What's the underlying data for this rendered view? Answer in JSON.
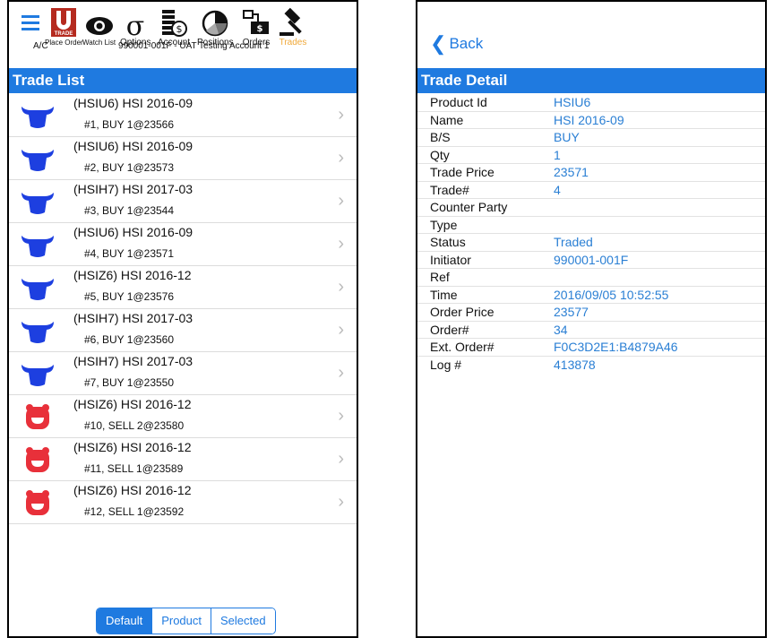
{
  "toolbar": {
    "items": [
      {
        "label": "Place Order",
        "icon": "trade-logo-icon"
      },
      {
        "label": "Watch List",
        "icon": "eye-icon"
      },
      {
        "label": "Options",
        "icon": "sigma-icon"
      },
      {
        "label": "Account",
        "icon": "coin-stack-icon"
      },
      {
        "label": "Positions",
        "icon": "pie-chart-icon"
      },
      {
        "label": "Orders",
        "icon": "orders-icon"
      },
      {
        "label": "Trades",
        "icon": "gavel-icon"
      }
    ],
    "logo_text": "TRADE",
    "account_label": "A/C",
    "account_value": "990001-001F - UAT Testing Account 1"
  },
  "trade_list": {
    "title": "Trade List",
    "rows": [
      {
        "line1": "(HSIU6) HSI 2016-09",
        "line2": "#1, BUY 1@23566",
        "side": "buy"
      },
      {
        "line1": "(HSIU6) HSI 2016-09",
        "line2": "#2, BUY 1@23573",
        "side": "buy"
      },
      {
        "line1": "(HSIH7) HSI 2017-03",
        "line2": "#3, BUY 1@23544",
        "side": "buy"
      },
      {
        "line1": "(HSIU6) HSI 2016-09",
        "line2": "#4, BUY 1@23571",
        "side": "buy"
      },
      {
        "line1": "(HSIZ6) HSI 2016-12",
        "line2": "#5, BUY 1@23576",
        "side": "buy"
      },
      {
        "line1": "(HSIH7) HSI 2017-03",
        "line2": "#6, BUY 1@23560",
        "side": "buy"
      },
      {
        "line1": "(HSIH7) HSI 2017-03",
        "line2": "#7, BUY 1@23550",
        "side": "buy"
      },
      {
        "line1": "(HSIZ6) HSI 2016-12",
        "line2": "#10, SELL 2@23580",
        "side": "sell"
      },
      {
        "line1": "(HSIZ6) HSI 2016-12",
        "line2": "#11, SELL 1@23589",
        "side": "sell"
      },
      {
        "line1": "(HSIZ6) HSI 2016-12",
        "line2": "#12, SELL 1@23592",
        "side": "sell"
      }
    ],
    "segments": [
      "Default",
      "Product",
      "Selected"
    ],
    "selected_segment": "Default"
  },
  "trade_detail": {
    "back_label": "Back",
    "title": "Trade Detail",
    "fields": [
      {
        "key": "Product Id",
        "value": "HSIU6"
      },
      {
        "key": "Name",
        "value": "HSI 2016-09"
      },
      {
        "key": "B/S",
        "value": "BUY"
      },
      {
        "key": "Qty",
        "value": "1"
      },
      {
        "key": "Trade Price",
        "value": "23571"
      },
      {
        "key": "Trade#",
        "value": "4"
      },
      {
        "key": "Counter Party",
        "value": ""
      },
      {
        "key": "Type",
        "value": ""
      },
      {
        "key": "Status",
        "value": "Traded"
      },
      {
        "key": "Initiator",
        "value": "990001-001F"
      },
      {
        "key": "Ref",
        "value": ""
      },
      {
        "key": "Time",
        "value": "2016/09/05 10:52:55"
      },
      {
        "key": "Order Price",
        "value": "23577"
      },
      {
        "key": "Order#",
        "value": "34"
      },
      {
        "key": "Ext. Order#",
        "value": "F0C3D2E1:B4879A46"
      },
      {
        "key": "Log #",
        "value": "413878"
      }
    ]
  },
  "colors": {
    "accent": "#1f7ae0",
    "buy": "#1d3fe0",
    "sell": "#e8303a",
    "active_tab": "#f0a93a"
  }
}
